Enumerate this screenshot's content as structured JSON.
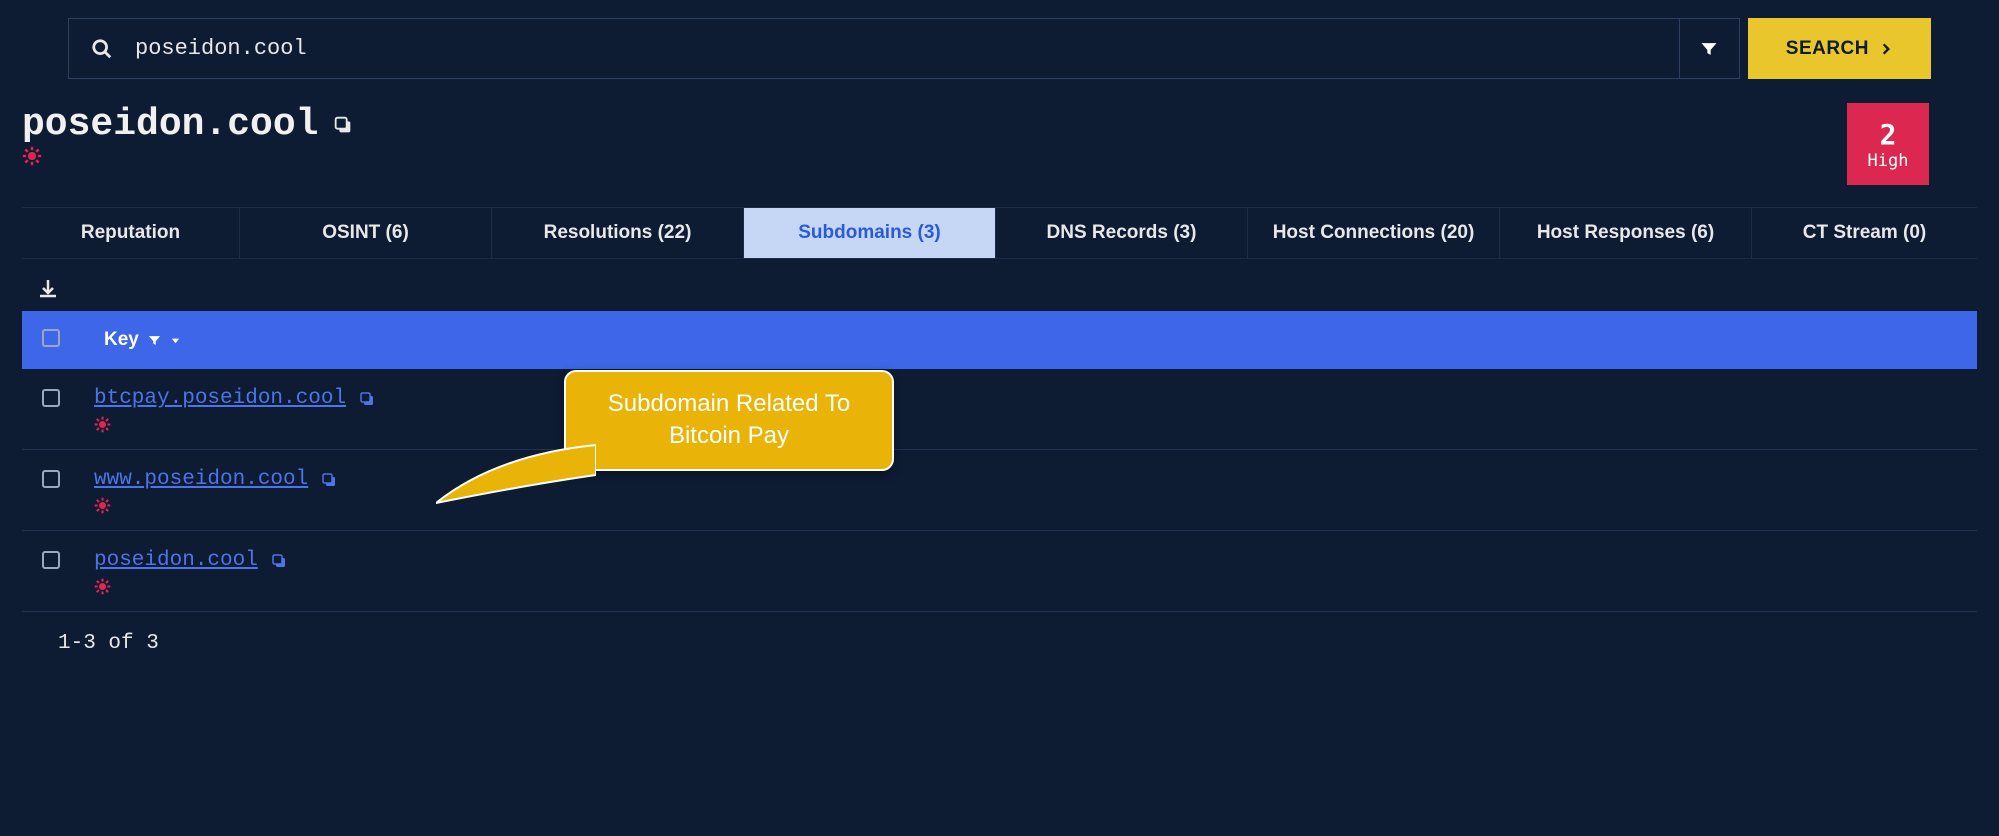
{
  "search": {
    "value": "poseidon.cool",
    "button_label": "SEARCH"
  },
  "page_title": "poseidon.cool",
  "risk": {
    "score": "2",
    "label": "High"
  },
  "tabs": [
    {
      "label": "Reputation",
      "active": false
    },
    {
      "label": "OSINT (6)",
      "active": false
    },
    {
      "label": "Resolutions (22)",
      "active": false
    },
    {
      "label": "Subdomains (3)",
      "active": true
    },
    {
      "label": "DNS Records (3)",
      "active": false
    },
    {
      "label": "Host Connections (20)",
      "active": false
    },
    {
      "label": "Host Responses (6)",
      "active": false
    },
    {
      "label": "CT Stream (0)",
      "active": false
    }
  ],
  "table": {
    "header_key": "Key",
    "rows": [
      {
        "domain": "btcpay.poseidon.cool"
      },
      {
        "domain": "www.poseidon.cool"
      },
      {
        "domain": "poseidon.cool"
      }
    ],
    "pager": "1-3 of 3"
  },
  "annotation": {
    "text": "Subdomain Related To Bitcoin Pay"
  }
}
